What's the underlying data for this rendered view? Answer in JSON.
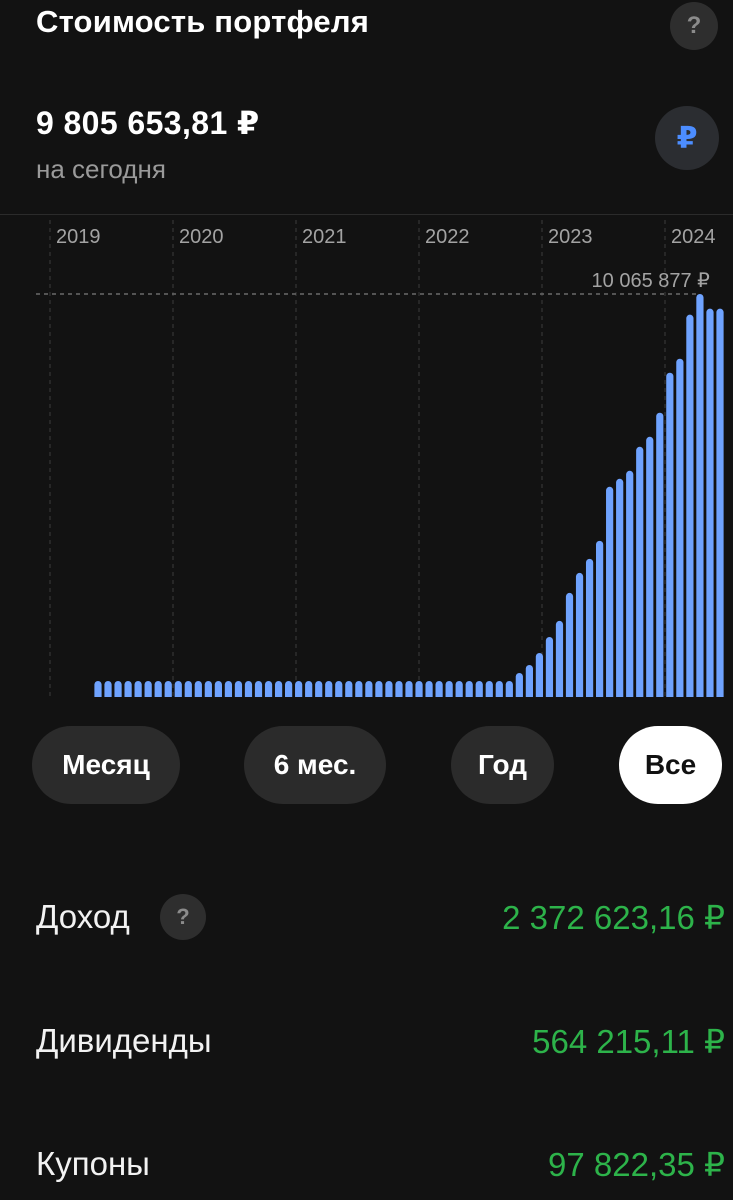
{
  "header": {
    "title": "Стоимость портфеля",
    "help_icon": "?"
  },
  "summary": {
    "value": "9 805 653,81 ₽",
    "subtitle": "на сегодня",
    "currency_symbol": "₽"
  },
  "chart_data": {
    "type": "bar",
    "title": "",
    "xlabel": "",
    "ylabel": "",
    "year_labels": [
      "2019",
      "2020",
      "2021",
      "2022",
      "2023",
      "2024"
    ],
    "max_label": "10 065 877 ₽",
    "max_value": 10065877,
    "ylim": [
      0,
      12000000
    ],
    "grid": "dashed vertical lines at year boundaries, dashed horizontal line at maximum",
    "x": [
      "2019-07",
      "2019-08",
      "2019-09",
      "2019-10",
      "2019-11",
      "2019-12",
      "2020-01",
      "2020-02",
      "2020-03",
      "2020-04",
      "2020-05",
      "2020-06",
      "2020-07",
      "2020-08",
      "2020-09",
      "2020-10",
      "2020-11",
      "2020-12",
      "2021-01",
      "2021-02",
      "2021-03",
      "2021-04",
      "2021-05",
      "2021-06",
      "2021-07",
      "2021-08",
      "2021-09",
      "2021-10",
      "2021-11",
      "2021-12",
      "2022-01",
      "2022-02",
      "2022-03",
      "2022-04",
      "2022-05",
      "2022-06",
      "2022-07",
      "2022-08",
      "2022-09",
      "2022-10",
      "2022-11",
      "2022-12",
      "2023-01",
      "2023-02",
      "2023-03",
      "2023-04",
      "2023-05",
      "2023-06",
      "2023-07",
      "2023-08",
      "2023-09",
      "2023-10",
      "2023-11",
      "2023-12",
      "2024-01",
      "2024-02",
      "2024-03",
      "2024-04"
    ],
    "values": [
      400000,
      400000,
      400000,
      400000,
      400000,
      400000,
      400000,
      400000,
      400000,
      400000,
      400000,
      400000,
      400000,
      400000,
      400000,
      400000,
      400000,
      400000,
      400000,
      400000,
      400000,
      400000,
      400000,
      400000,
      400000,
      400000,
      400000,
      400000,
      400000,
      400000,
      400000,
      400000,
      400000,
      400000,
      400000,
      400000,
      400000,
      400000,
      400000,
      400000,
      400000,
      400000,
      600000,
      800000,
      1100000,
      1500000,
      1900000,
      2600000,
      3100000,
      3450000,
      3900000,
      5250000,
      5450000,
      5650000,
      6250000,
      6500000,
      7100000,
      8100000,
      8450000,
      9550000,
      10065877,
      9700000,
      9700000
    ]
  },
  "filters": [
    {
      "label": "Месяц",
      "active": false
    },
    {
      "label": "6 мес.",
      "active": false
    },
    {
      "label": "Год",
      "active": false
    },
    {
      "label": "Все",
      "active": true
    }
  ],
  "stats": [
    {
      "label": "Доход",
      "value": "2 372 623,16 ₽",
      "has_help": true,
      "help_icon": "?"
    },
    {
      "label": "Дивиденды",
      "value": "564 215,11 ₽",
      "has_help": false
    },
    {
      "label": "Купоны",
      "value": "97 822,35 ₽",
      "has_help": false
    }
  ],
  "colors": {
    "background": "#121212",
    "bar": "#6fa3ff",
    "positive": "#2db34a",
    "accent": "#4c8dff"
  }
}
